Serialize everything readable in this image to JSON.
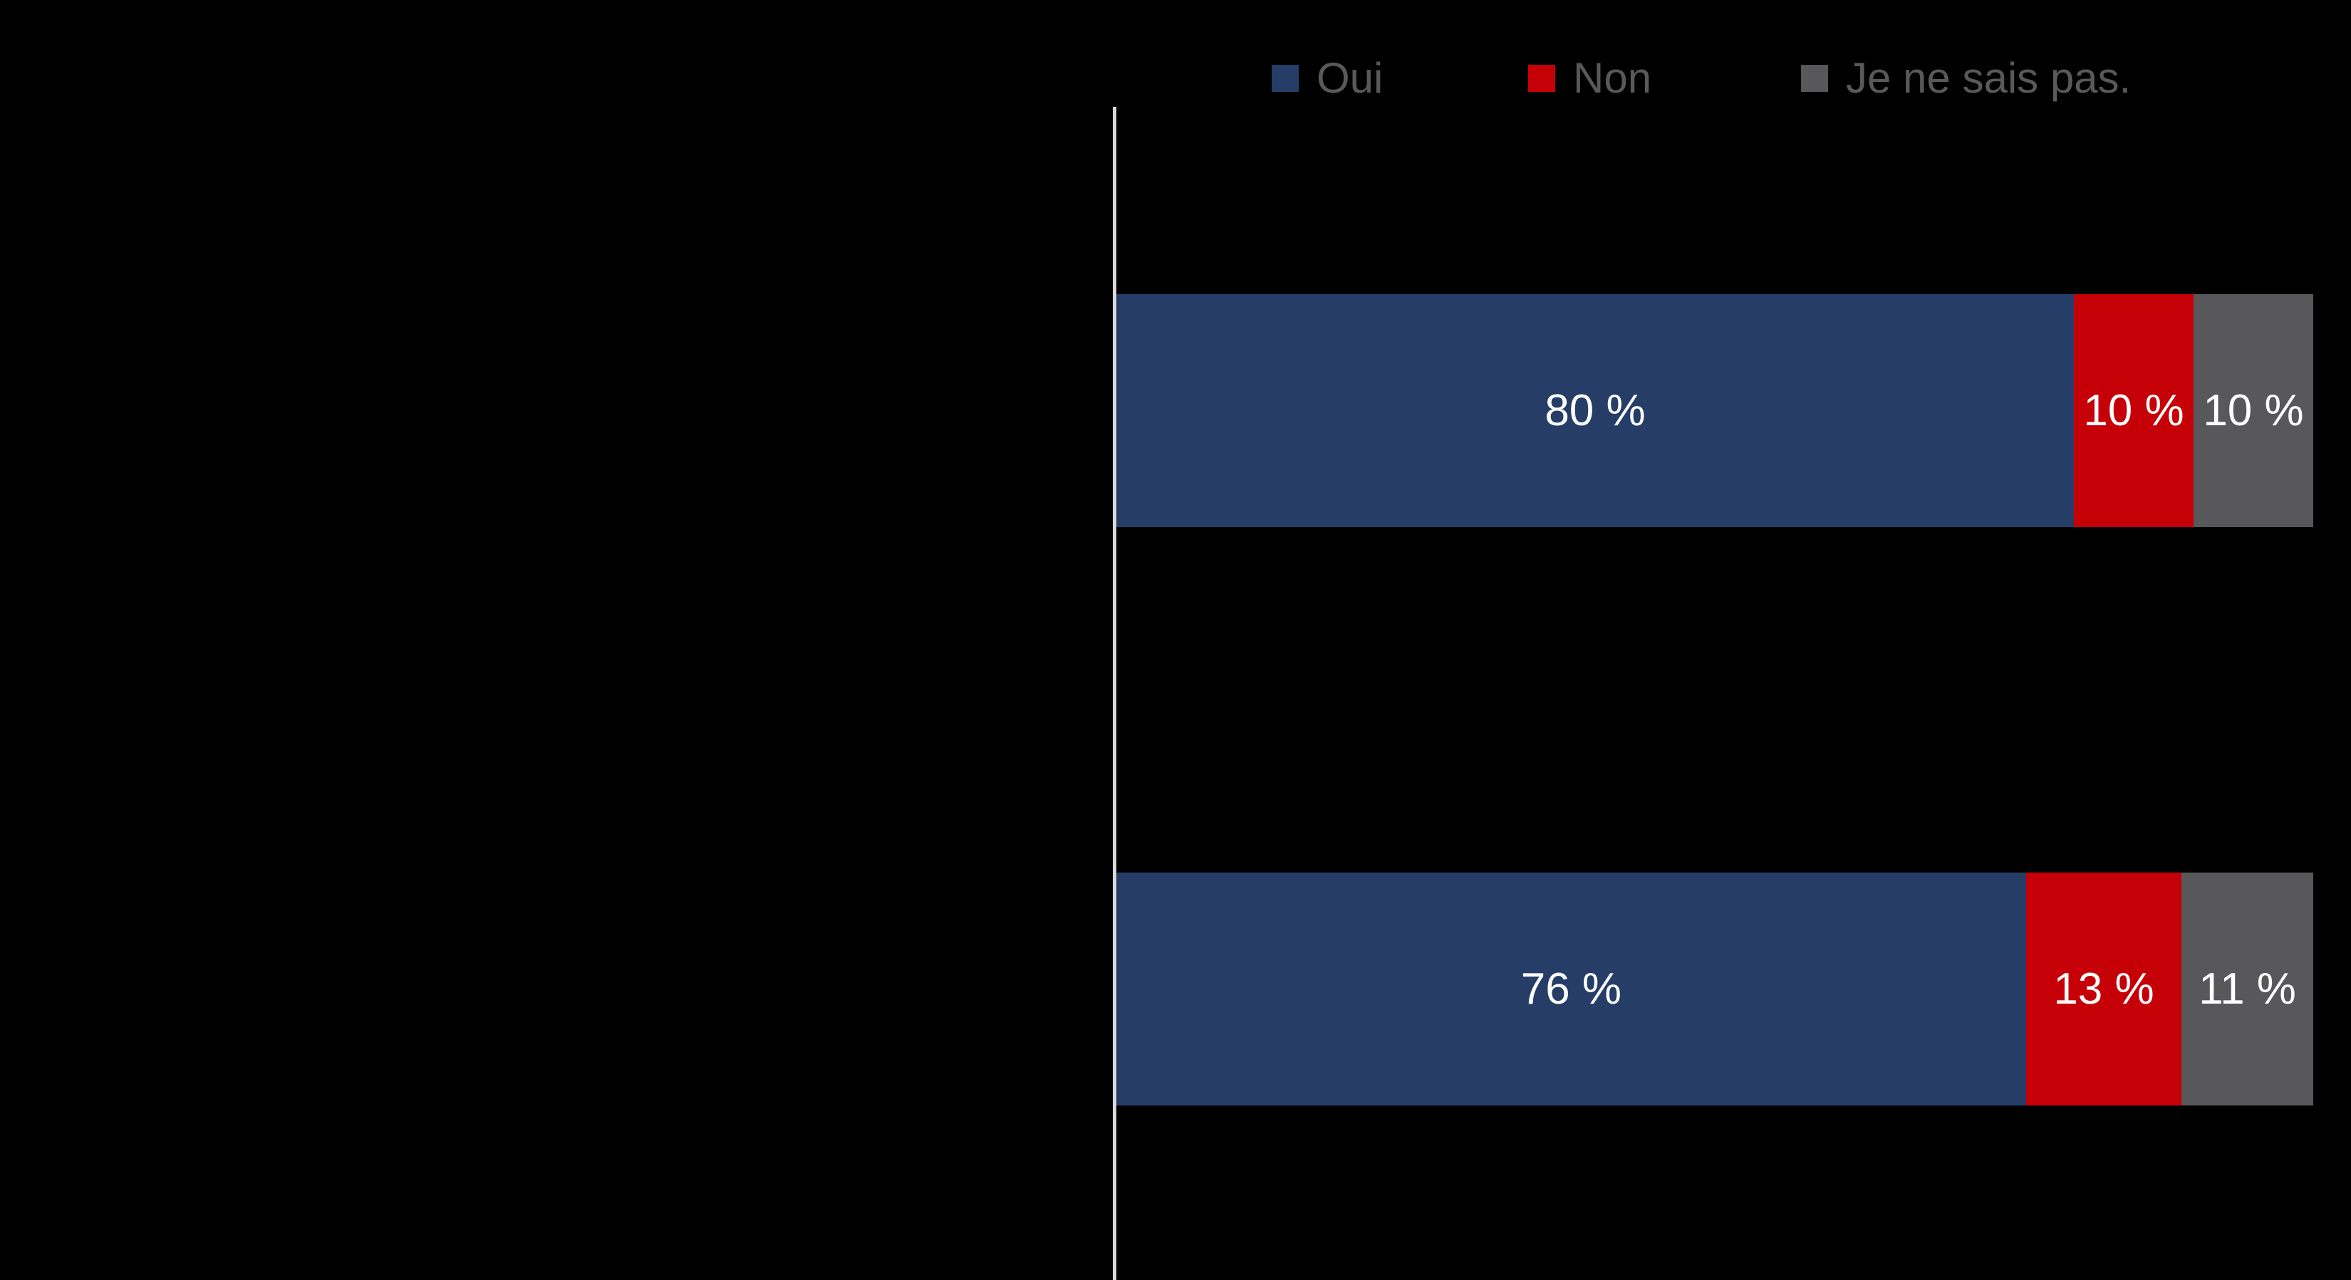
{
  "legend": {
    "position": "top",
    "items": [
      {
        "label": "Oui",
        "color": "#253D67",
        "swatch": "square-marker-icon"
      },
      {
        "label": "Non",
        "color": "#C60007",
        "swatch": "square-marker-icon"
      },
      {
        "label": "Je ne sais pas.",
        "color": "#58585A",
        "swatch": "square-marker-icon"
      }
    ]
  },
  "chart_data": {
    "type": "bar",
    "orientation": "horizontal",
    "stacked": true,
    "stack_mode": "percent",
    "title": "",
    "subtitle": "",
    "xlabel": "",
    "ylabel": "",
    "xlim": [
      0,
      100
    ],
    "grid": false,
    "legend_position": "top",
    "categories": [
      "",
      ""
    ],
    "series": [
      {
        "name": "Oui",
        "color": "#253D67",
        "values": [
          80,
          76
        ],
        "labels": [
          "80 %",
          "76 %"
        ]
      },
      {
        "name": "Non",
        "color": "#C60007",
        "values": [
          10,
          13
        ],
        "labels": [
          "10 %",
          "13 %"
        ]
      },
      {
        "name": "Je ne sais pas.",
        "color": "#58585A",
        "values": [
          10,
          11
        ],
        "labels": [
          "10 %",
          "11 %"
        ]
      }
    ],
    "bars": [
      {
        "segments": [
          {
            "series": "Oui",
            "value": 80,
            "label": "80 %"
          },
          {
            "series": "Non",
            "value": 10,
            "label": "10 %"
          },
          {
            "series": "Je ne sais pas.",
            "value": 10,
            "label": "10 %"
          }
        ]
      },
      {
        "segments": [
          {
            "series": "Oui",
            "value": 76,
            "label": "76 %"
          },
          {
            "series": "Non",
            "value": 13,
            "label": "13 %"
          },
          {
            "series": "Je ne sais pas.",
            "value": 11,
            "label": "11 %"
          }
        ]
      }
    ]
  },
  "colors": {
    "background": "#000000",
    "axis": "#D9D9D9",
    "legend_text": "#595959",
    "data_label_text": "#FFFFFF"
  }
}
